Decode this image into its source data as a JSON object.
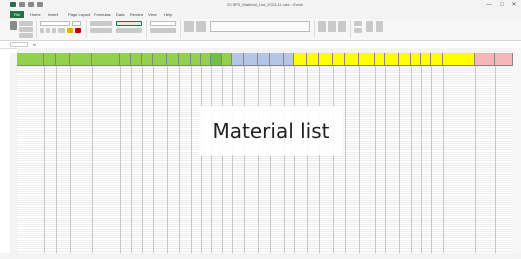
{
  "window": {
    "title": "20 SP3_Material_List_2023-11.xlsx - Excel",
    "controls": [
      "—",
      "□",
      "✕"
    ]
  },
  "ribbon_tabs": [
    "File",
    "Home",
    "Insert",
    "Page Layout",
    "Formulas",
    "Data",
    "Review",
    "View",
    "Help"
  ],
  "ribbon": {
    "font_name": "",
    "font_size": "",
    "number_format": ""
  },
  "formula_bar": {
    "name_box": "",
    "fx": "fx",
    "content": ""
  },
  "overlay": {
    "text": "Material list"
  },
  "colors": {
    "excel_green": "#217346",
    "header_green": "#92d050",
    "header_blue": "#b4c6e7",
    "header_yellow": "#ffff00",
    "header_pink": "#f4b6b6",
    "header_gray": "#d9d9d9"
  },
  "icons": [
    "save-icon",
    "undo-icon",
    "redo-icon",
    "minimize-icon",
    "maximize-icon",
    "close-icon"
  ]
}
